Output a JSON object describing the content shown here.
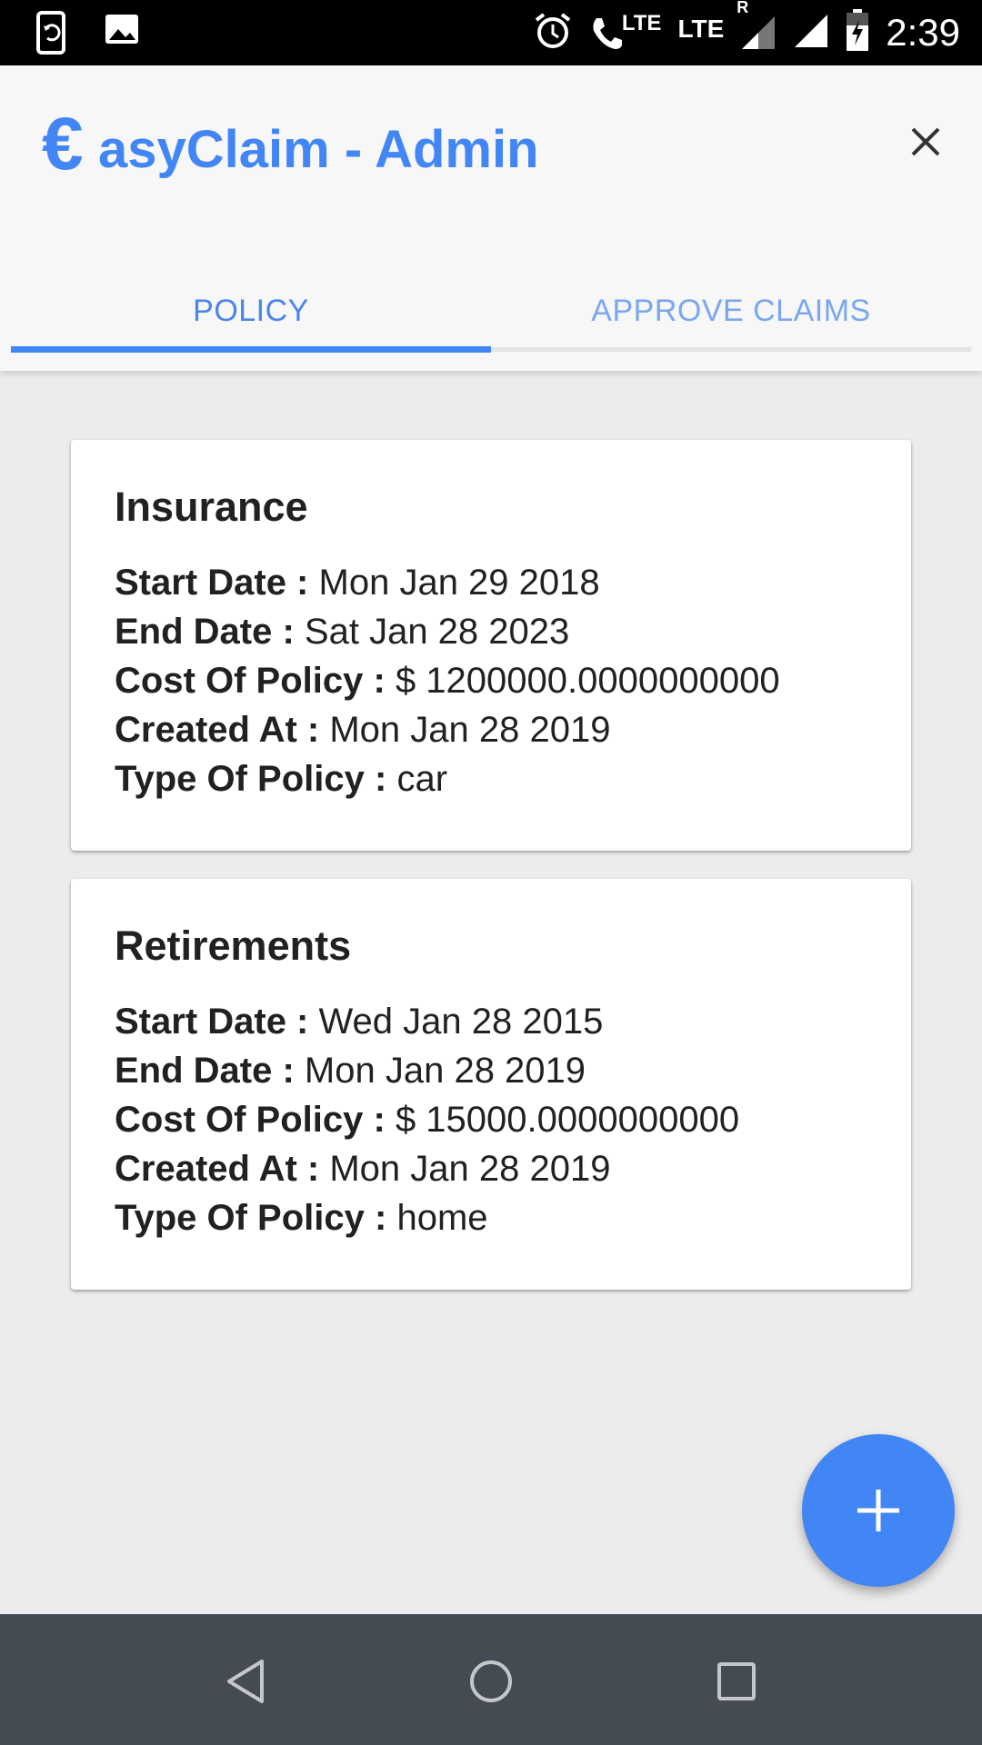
{
  "statusbar": {
    "time": "2:39",
    "lte1": "LTE",
    "lte2": "LTE",
    "roaming": "R",
    "icons": [
      "screen-rotate-icon",
      "image-icon",
      "alarm-icon",
      "volte-call-icon",
      "signal-icon",
      "signal-full-icon",
      "battery-charging-icon"
    ]
  },
  "header": {
    "logo": "€",
    "title": "asyClaim - Admin",
    "close_icon": "close-icon"
  },
  "tabs": [
    {
      "label": "POLICY",
      "active": true
    },
    {
      "label": "APPROVE CLAIMS",
      "active": false
    }
  ],
  "policies": [
    {
      "title": "Insurance",
      "start_label": "Start Date :",
      "start": "Mon Jan 29 2018",
      "end_label": "End Date :",
      "end": "Sat Jan 28 2023",
      "cost_label": "Cost Of Policy :",
      "cost": "$ 1200000.0000000000",
      "created_label": "Created At :",
      "created": "Mon Jan 28 2019",
      "type_label": "Type Of Policy :",
      "type": "car"
    },
    {
      "title": "Retirements",
      "start_label": "Start Date :",
      "start": "Wed Jan 28 2015",
      "end_label": "End Date :",
      "end": "Mon Jan 28 2019",
      "cost_label": "Cost Of Policy :",
      "cost": "$ 15000.0000000000",
      "created_label": "Created At :",
      "created": "Mon Jan 28 2019",
      "type_label": "Type Of Policy :",
      "type": "home"
    }
  ],
  "fab": {
    "icon": "plus-icon"
  },
  "navbar": {
    "icons": [
      "back-icon",
      "home-icon",
      "recents-icon"
    ]
  },
  "colors": {
    "accent": "#4285f4",
    "navbar": "#454b52",
    "background": "#ececec"
  }
}
